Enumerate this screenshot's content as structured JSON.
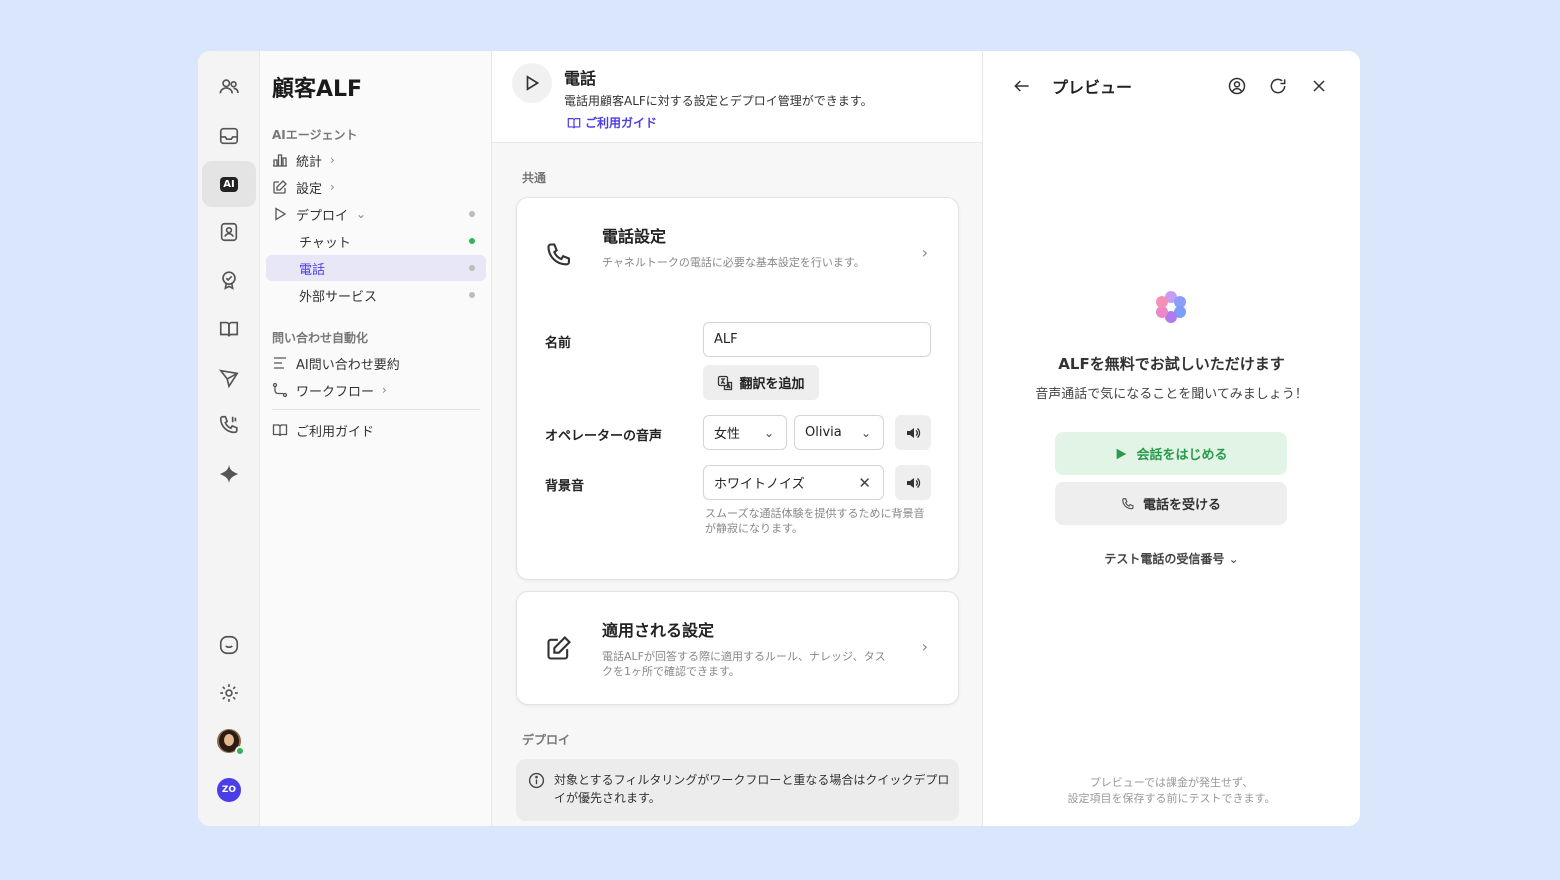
{
  "app": {
    "title": "顧客ALF"
  },
  "nav": {
    "section_agent": "AIエージェント",
    "stats": "統計",
    "settings": "設定",
    "deploy": "デプロイ",
    "chat": "チャット",
    "phone": "電話",
    "external": "外部サービス",
    "section_automation": "問い合わせ自動化",
    "ai_summary": "AI問い合わせ要約",
    "workflow": "ワークフロー",
    "guide": "ご利用ガイド"
  },
  "header": {
    "title": "電話",
    "description": "電話用顧客ALFに対する設定とデプロイ管理ができます。",
    "guide_link": "ご利用ガイド"
  },
  "common": {
    "section_label": "共通",
    "phone_settings": {
      "title": "電話設定",
      "description": "チャネルトークの電話に必要な基本設定を行います。"
    },
    "name_label": "名前",
    "name_value": "ALF",
    "add_translation": "翻訳を追加",
    "voice_label": "オペレーターの音声",
    "gender_value": "女性",
    "voice_value": "Olivia",
    "bg_label": "背景音",
    "bg_value": "ホワイトノイズ",
    "bg_hint": "スムーズな通話体験を提供するために背景音が静寂になります。",
    "applied": {
      "title": "適用される設定",
      "description": "電話ALFが回答する際に適用するルール、ナレッジ、タスクを1ヶ所で確認できます。"
    }
  },
  "deploy": {
    "section_label": "デプロイ",
    "info": "対象とするフィルタリングがワークフローと重なる場合はクイックデプロイが優先されます。"
  },
  "preview": {
    "title": "プレビュー",
    "heading": "ALFを無料でお試しいただけます",
    "subheading": "音声通話で気になることを聞いてみましょう！",
    "start_button": "会話をはじめる",
    "receive_button": "電話を受ける",
    "test_number": "テスト電話の受信番号",
    "footer_line1": "プレビューでは課金が発生せず、",
    "footer_line2": "設定項目を保存する前にテストできます。"
  },
  "colors": {
    "accent": "#4b3ee6",
    "active_bg": "#e7e7f7",
    "green": "#2fb55c"
  }
}
